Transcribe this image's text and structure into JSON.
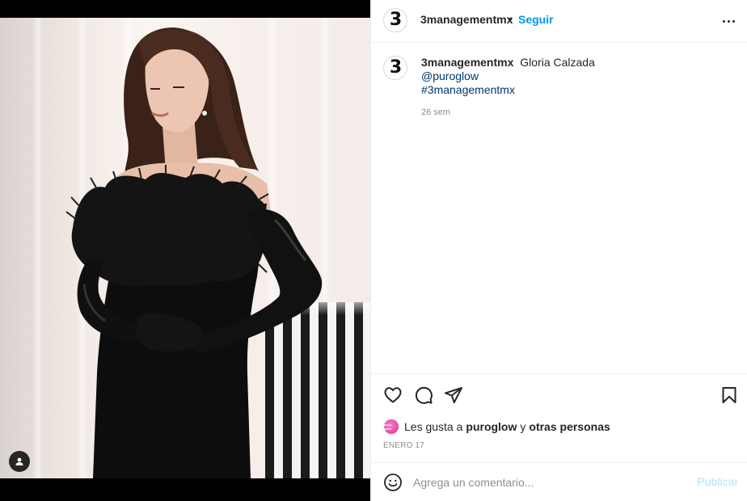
{
  "post": {
    "author": "3managementmx",
    "avatar_letter": "3",
    "follow_label": "Seguir",
    "separator": "•",
    "more_icon": "more-horizontal-icon"
  },
  "caption": {
    "author": "3managementmx",
    "text": "Gloria Calzada",
    "mention": "@puroglow",
    "hashtag": "#3managementmx",
    "time_ago": "26 sem"
  },
  "media": {
    "tag_icon": "user-tag-icon"
  },
  "actions": {
    "like_icon": "heart-icon",
    "comment_icon": "comment-icon",
    "share_icon": "send-icon",
    "save_icon": "bookmark-icon"
  },
  "likes": {
    "prefix": "Les gusta a",
    "first_user": "puroglow",
    "conjunction": "y",
    "others": "otras personas",
    "avatar_text": "puro glow"
  },
  "date": "ENERO 17",
  "comment": {
    "placeholder": "Agrega un comentario...",
    "publish_label": "Publicar",
    "emoji_icon": "smiley-icon"
  },
  "colors": {
    "link": "#00376b",
    "follow": "#0095f6",
    "publish_disabled": "#b2dffc",
    "muted": "#8e8e8e"
  }
}
